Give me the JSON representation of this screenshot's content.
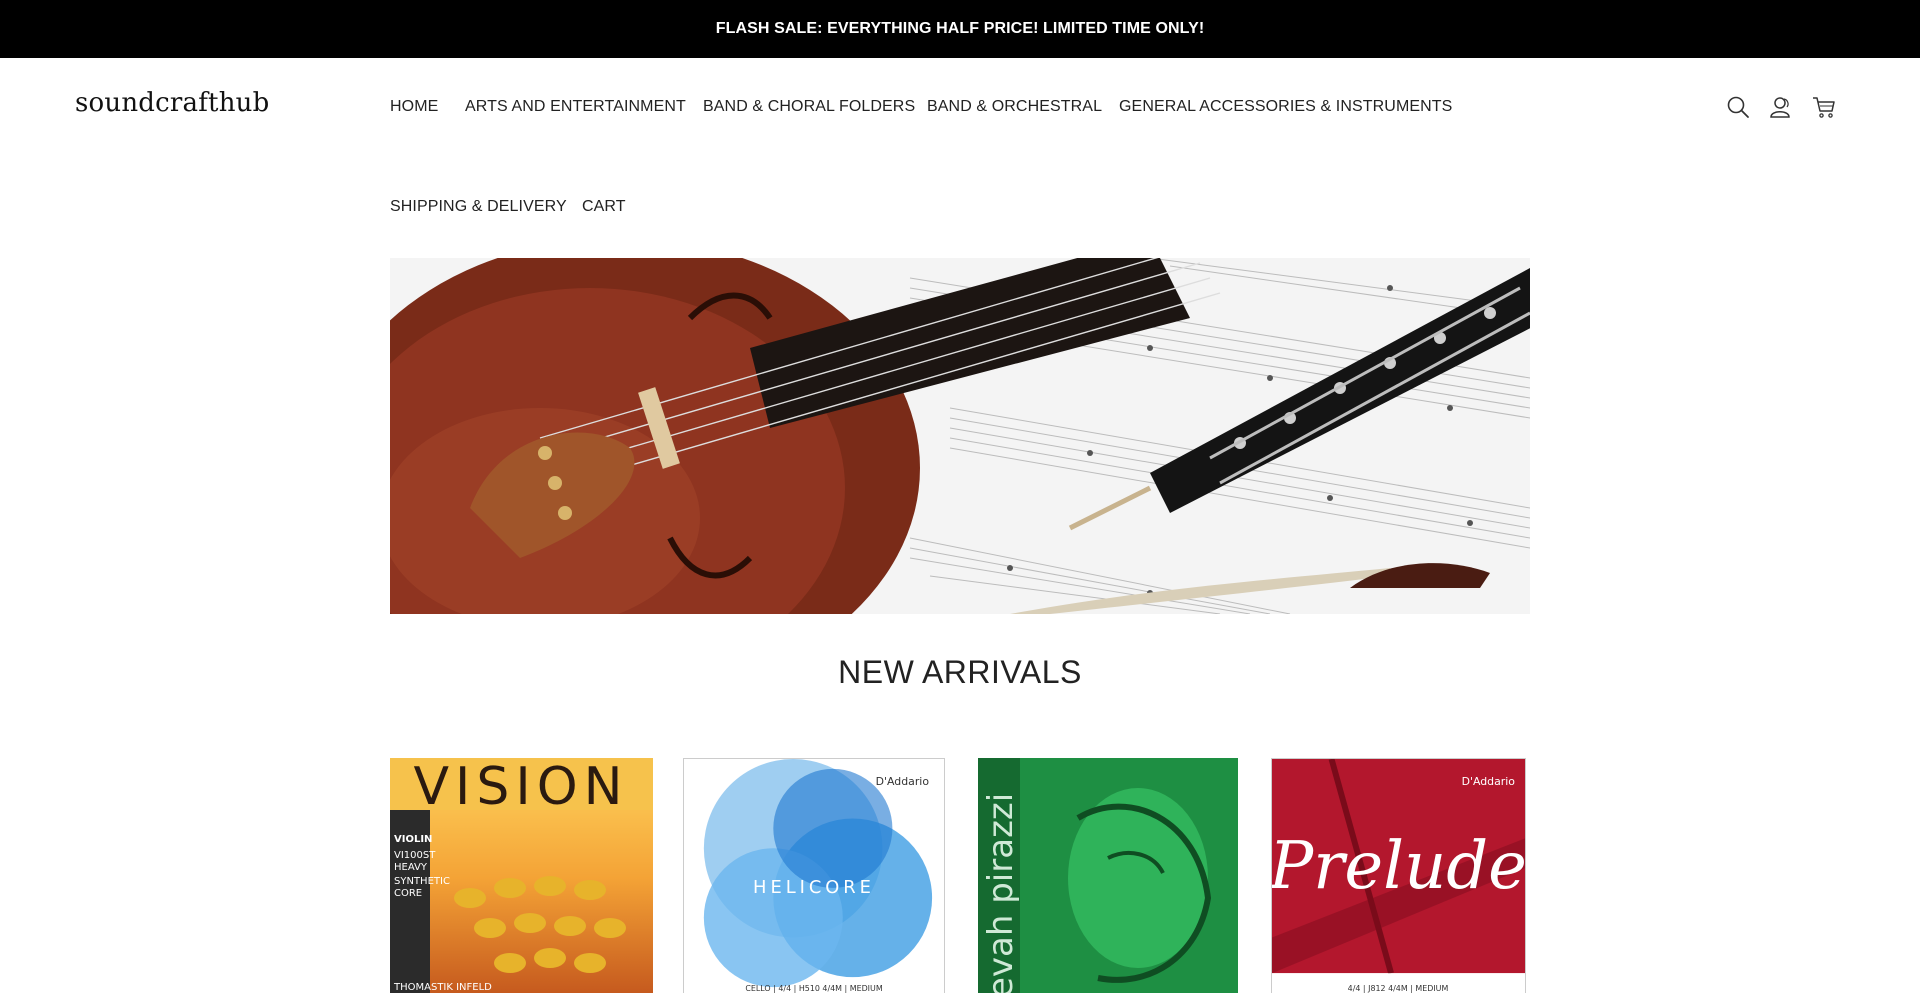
{
  "announcement": {
    "text": "FLASH SALE: EVERYTHING HALF PRICE! LIMITED TIME ONLY!"
  },
  "header": {
    "logo": "soundcrafthub",
    "nav": [
      "HOME",
      "ARTS AND ENTERTAINMENT",
      "BAND & CHORAL FOLDERS",
      "BAND & ORCHESTRAL",
      "GENERAL ACCESSORIES & INSTRUMENTS",
      "SHIPPING & DELIVERY",
      "CART"
    ],
    "icons": [
      "search-icon",
      "account-icon",
      "cart-icon"
    ]
  },
  "hero": {
    "image": "violin-and-oboe-on-sheet-music"
  },
  "new_arrivals": {
    "title": "NEW ARRIVALS",
    "products": [
      {
        "image": "vision-violin-strings",
        "label": {
          "brand": "VISION",
          "lines": [
            "VIOLIN",
            "VI100ST",
            "HEAVY",
            "SYNTHETIC",
            "CORE"
          ],
          "maker": "THOMASTIK INFELD"
        }
      },
      {
        "image": "helicore-cello-strings",
        "label": {
          "brand": "D'Addario",
          "name": "HELICORE",
          "footer": "CELLO | 4/4 | H510 4/4M | MEDIUM"
        }
      },
      {
        "image": "evah-pirazzi-strings",
        "label": {
          "brand": "evah pirazzi"
        }
      },
      {
        "image": "prelude-strings",
        "label": {
          "brand": "D'Addario",
          "name": "Prelude",
          "footer": "4/4 | J812 4/4M | MEDIUM"
        }
      }
    ]
  },
  "colors": {
    "announcement_bg": "#000000",
    "text": "#222222"
  }
}
